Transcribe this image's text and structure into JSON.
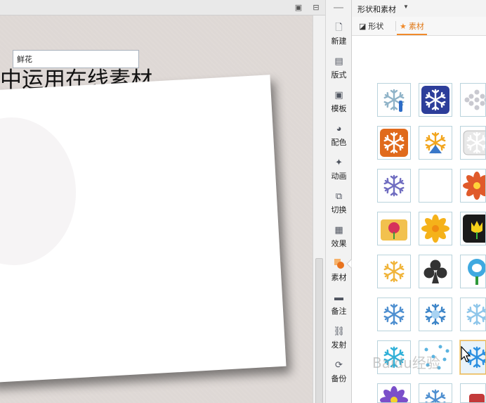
{
  "document": {
    "slide_title": "中运用在线素材"
  },
  "tool_strip": {
    "items": [
      {
        "label": "新建",
        "icon": "new-doc-icon"
      },
      {
        "label": "版式",
        "icon": "layout-icon"
      },
      {
        "label": "模板",
        "icon": "template-icon"
      },
      {
        "label": "配色",
        "icon": "palette-icon"
      },
      {
        "label": "动画",
        "icon": "animation-icon"
      },
      {
        "label": "切换",
        "icon": "transition-icon"
      },
      {
        "label": "效果",
        "icon": "effect-icon"
      },
      {
        "label": "素材",
        "icon": "material-icon",
        "active": true
      },
      {
        "label": "备注",
        "icon": "note-icon"
      },
      {
        "label": "发射",
        "icon": "link-icon"
      },
      {
        "label": "备份",
        "icon": "backup-icon"
      }
    ]
  },
  "panel": {
    "title": "形状和素材",
    "tabs": [
      {
        "label": "形状",
        "icon": "shapes-icon"
      },
      {
        "label": "素材",
        "icon": "star-icon",
        "active": true
      }
    ],
    "search_value": "鲜花",
    "grid": [
      "snowflake-thermometer",
      "snowflake-blue-square",
      "snowflake-dots",
      "snowflake-orange-square",
      "snowflake-gold-blue",
      "snowflake-grey-button",
      "snowflake-purple-outline",
      "blank",
      "hibiscus-flower",
      "flower-folder",
      "yellow-flower",
      "tulip-black-icon",
      "snowflake-gold",
      "club-suit",
      "fire-flower",
      "snowflake-blue-outline",
      "snowflake-blue-gradient",
      "snowflake-light",
      "snowflake-cyan",
      "snowflake-scatter",
      "snowflake-blue-cursor",
      "purple-flower",
      "snowflake-partial",
      "red-partial"
    ],
    "selected_index": 20
  },
  "watermark": "Baidu经验",
  "colors": {
    "accent": "#f08a2a",
    "panel_border": "#b9d3dc",
    "canvas_bg": "#ded8d5"
  }
}
